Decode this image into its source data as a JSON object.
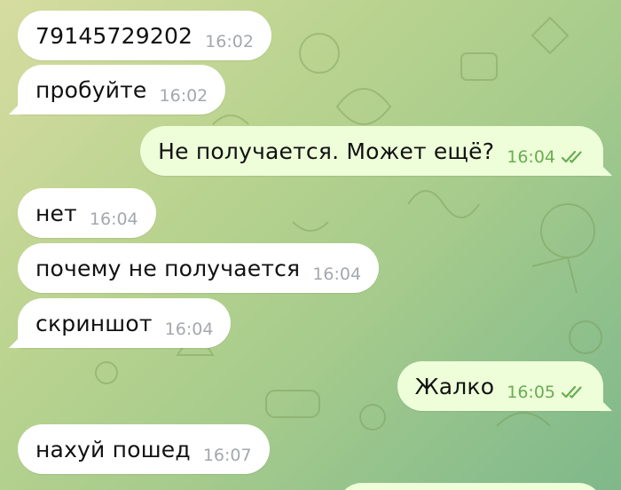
{
  "colors": {
    "incoming_bubble": "#ffffff",
    "outgoing_bubble": "#eefed9",
    "time_incoming": "#a4a8ad",
    "time_outgoing": "#6aac53"
  },
  "messages": [
    {
      "text": "79145729202",
      "time": "16:02",
      "direction": "incoming"
    },
    {
      "text": "пробуйте",
      "time": "16:02",
      "direction": "incoming"
    },
    {
      "text": "Не получается. Может ещё?",
      "time": "16:04",
      "direction": "outgoing",
      "status_icon": "double-check-icon"
    },
    {
      "text": "нет",
      "time": "16:04",
      "direction": "incoming"
    },
    {
      "text": "почему не получается",
      "time": "16:04",
      "direction": "incoming"
    },
    {
      "text": "скриншот",
      "time": "16:04",
      "direction": "incoming"
    },
    {
      "text": "Жалко",
      "time": "16:05",
      "direction": "outgoing",
      "status_icon": "double-check-icon"
    },
    {
      "text": "нахуй пошед",
      "time": "16:07",
      "direction": "incoming"
    }
  ]
}
